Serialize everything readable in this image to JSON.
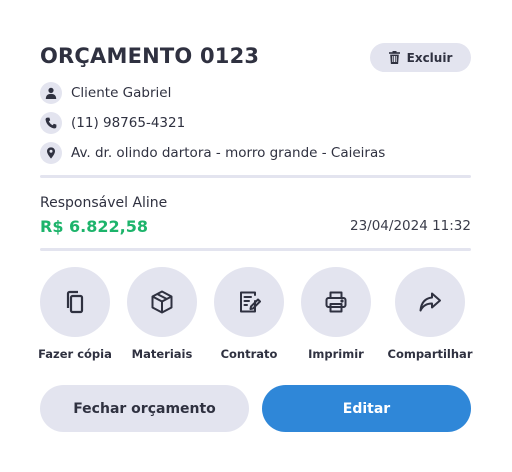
{
  "header": {
    "title": "ORÇAMENTO 0123",
    "delete_label": "Excluir"
  },
  "info": {
    "client": "Cliente Gabriel",
    "phone": "(11) 98765-4321",
    "address": "Av. dr. olindo dartora - morro grande - Caieiras"
  },
  "summary": {
    "responsible": "Responsável Aline",
    "amount": "R$ 6.822,58",
    "date": "23/04/2024 11:32"
  },
  "actions": [
    {
      "label": "Fazer cópia",
      "icon": "copy-icon"
    },
    {
      "label": "Materiais",
      "icon": "box-icon"
    },
    {
      "label": "Contrato",
      "icon": "contract-icon"
    },
    {
      "label": "Imprimir",
      "icon": "printer-icon"
    },
    {
      "label": "Compartilhar",
      "icon": "share-icon"
    }
  ],
  "buttons": {
    "close_label": "Fechar orçamento",
    "edit_label": "Editar"
  },
  "colors": {
    "accent": "#2f87d8",
    "amount": "#1db46b",
    "chip_bg": "#e3e4ef",
    "text": "#2f3140"
  }
}
